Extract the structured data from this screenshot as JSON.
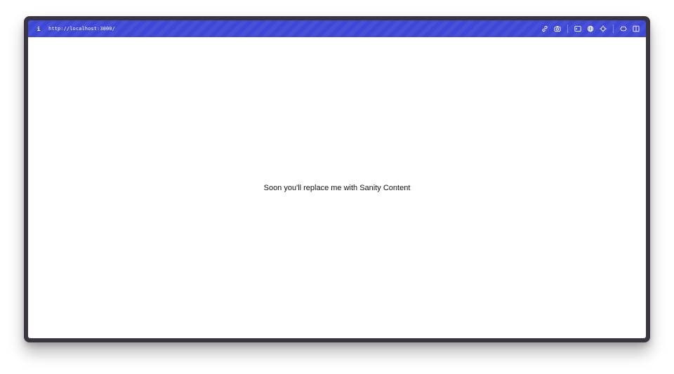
{
  "toolbar": {
    "info_glyph": "i",
    "url": "http://localhost:3000/",
    "icons": [
      "link-icon",
      "camera-icon",
      "terminal-icon",
      "globe-icon",
      "crosshair-icon",
      "resize-icon",
      "split-view-icon"
    ],
    "background_color": "#3d48d6"
  },
  "main": {
    "message": "Soon you'll replace me with Sanity Content"
  },
  "colors": {
    "frame": "#3a3540",
    "accent": "#3d48d6",
    "content_bg": "#ffffff"
  }
}
